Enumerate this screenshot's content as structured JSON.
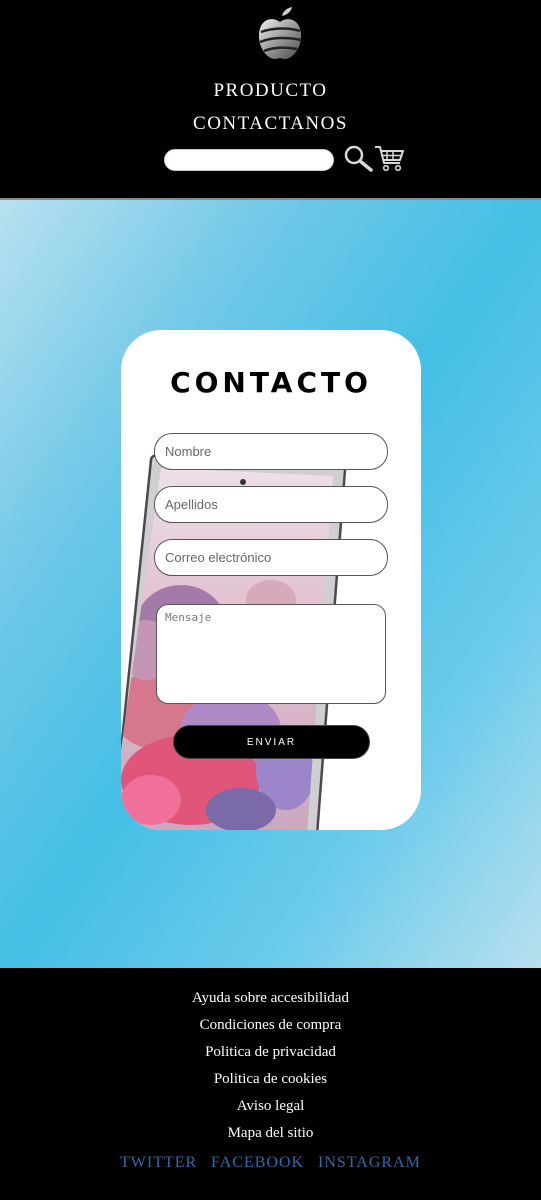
{
  "header": {
    "nav": {
      "product": "PRODUCTO",
      "contact": "CONTACTANOS"
    },
    "search": {
      "value": "",
      "placeholder": ""
    },
    "icons": {
      "logo": "apple-logo-icon",
      "search": "magnifier-icon",
      "cart": "cart-icon"
    }
  },
  "contact_form": {
    "title": "CONTACTO",
    "fields": {
      "nombre": "Nombre",
      "apellidos": "Apellidos",
      "correo": "Correo electrónico",
      "mensaje": "Mensaje"
    },
    "submit_label": "ENVIAR"
  },
  "footer": {
    "links": [
      "Ayuda sobre accesibilidad",
      "Condiciones de compra",
      "Politica de privacidad",
      "Politica de cookies",
      "Aviso legal",
      "Mapa del sitio"
    ],
    "social": [
      "TWITTER",
      "FACEBOOK",
      "INSTAGRAM"
    ]
  },
  "colors": {
    "header_bg": "#000000",
    "main_gradient": "#45bfe6",
    "footer_bg": "#000000",
    "social_link": "#2f6ca8"
  }
}
